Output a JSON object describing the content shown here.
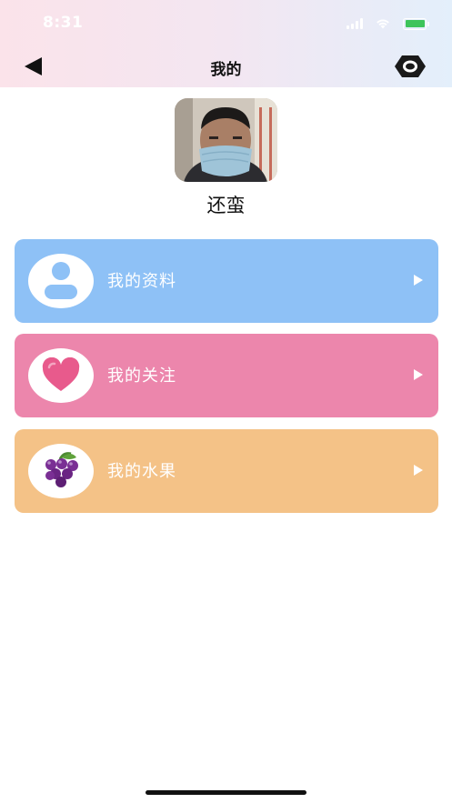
{
  "status_bar": {
    "time": "8:31"
  },
  "nav": {
    "title": "我的"
  },
  "profile": {
    "username": "还蛮"
  },
  "menu": [
    {
      "label": "我的资料",
      "icon": "user-icon",
      "color": "#8ec1f6"
    },
    {
      "label": "我的关注",
      "icon": "heart-icon",
      "color": "#ec86ac"
    },
    {
      "label": "我的水果",
      "icon": "grapes-icon",
      "color": "#f4c287"
    }
  ]
}
